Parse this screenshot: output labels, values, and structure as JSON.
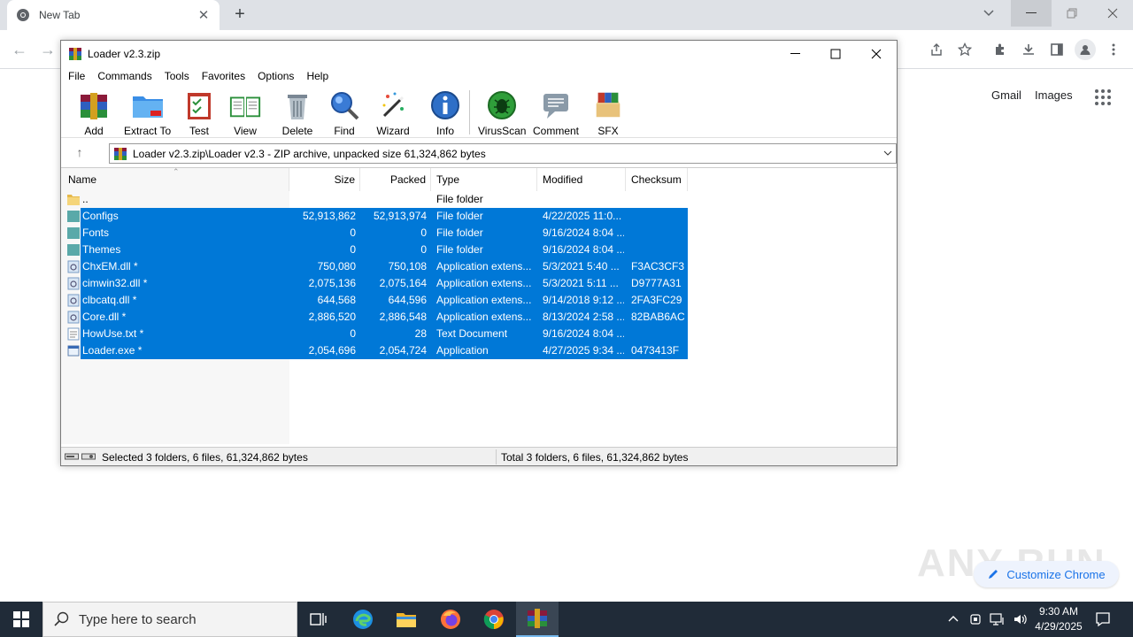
{
  "browser": {
    "tab_title": "New Tab",
    "links": {
      "gmail": "Gmail",
      "images": "Images"
    },
    "customize_label": "Customize Chrome",
    "watermark": "ANY RUN"
  },
  "window": {
    "title": "Loader v2.3.zip",
    "menu": [
      "File",
      "Commands",
      "Tools",
      "Favorites",
      "Options",
      "Help"
    ],
    "toolbar": [
      {
        "label": "Add",
        "icon": "add-archive-icon"
      },
      {
        "label": "Extract To",
        "icon": "extract-folder-icon"
      },
      {
        "label": "Test",
        "icon": "test-clipboard-icon"
      },
      {
        "label": "View",
        "icon": "view-book-icon"
      },
      {
        "label": "Delete",
        "icon": "trash-icon"
      },
      {
        "label": "Find",
        "icon": "magnifier-icon"
      },
      {
        "label": "Wizard",
        "icon": "wand-icon"
      },
      {
        "label": "Info",
        "icon": "info-icon"
      },
      {
        "label": "VirusScan",
        "icon": "virus-scan-icon"
      },
      {
        "label": "Comment",
        "icon": "comment-icon"
      },
      {
        "label": "SFX",
        "icon": "sfx-icon"
      }
    ],
    "address": "Loader v2.3.zip\\Loader v2.3 - ZIP archive, unpacked size 61,324,862 bytes",
    "columns": {
      "name": "Name",
      "size": "Size",
      "packed": "Packed",
      "type": "Type",
      "modified": "Modified",
      "checksum": "Checksum"
    },
    "rows": [
      {
        "name": "..",
        "size": "",
        "packed": "",
        "type": "File folder",
        "modified": "",
        "checksum": "",
        "kind": "folder"
      },
      {
        "name": "Configs",
        "size": "52,913,862",
        "packed": "52,913,974",
        "type": "File folder",
        "modified": "4/22/2025 11:0...",
        "checksum": "",
        "kind": "folder"
      },
      {
        "name": "Fonts",
        "size": "0",
        "packed": "0",
        "type": "File folder",
        "modified": "9/16/2024 8:04 ...",
        "checksum": "",
        "kind": "folder"
      },
      {
        "name": "Themes",
        "size": "0",
        "packed": "0",
        "type": "File folder",
        "modified": "9/16/2024 8:04 ...",
        "checksum": "",
        "kind": "folder"
      },
      {
        "name": "ChxEM.dll *",
        "size": "750,080",
        "packed": "750,108",
        "type": "Application extens...",
        "modified": "5/3/2021 5:40 ...",
        "checksum": "F3AC3CF3",
        "kind": "dll"
      },
      {
        "name": "cimwin32.dll *",
        "size": "2,075,136",
        "packed": "2,075,164",
        "type": "Application extens...",
        "modified": "5/3/2021 5:11 ...",
        "checksum": "D9777A31",
        "kind": "dll"
      },
      {
        "name": "clbcatq.dll *",
        "size": "644,568",
        "packed": "644,596",
        "type": "Application extens...",
        "modified": "9/14/2018 9:12 ...",
        "checksum": "2FA3FC29",
        "kind": "dll"
      },
      {
        "name": "Core.dll *",
        "size": "2,886,520",
        "packed": "2,886,548",
        "type": "Application extens...",
        "modified": "8/13/2024 2:58 ...",
        "checksum": "82BAB6AC",
        "kind": "dll"
      },
      {
        "name": "HowUse.txt *",
        "size": "0",
        "packed": "28",
        "type": "Text Document",
        "modified": "9/16/2024 8:04 ...",
        "checksum": "",
        "kind": "txt"
      },
      {
        "name": "Loader.exe *",
        "size": "2,054,696",
        "packed": "2,054,724",
        "type": "Application",
        "modified": "4/27/2025 9:34 ...",
        "checksum": "0473413F",
        "kind": "exe"
      }
    ],
    "status_left": "Selected 3 folders, 6 files, 61,324,862 bytes",
    "status_right": "Total 3 folders, 6 files, 61,324,862 bytes"
  },
  "taskbar": {
    "search_placeholder": "Type here to search",
    "time": "9:30 AM",
    "date": "4/29/2025"
  },
  "colors": {
    "selection": "#0078d7",
    "taskbar": "#202b38"
  }
}
